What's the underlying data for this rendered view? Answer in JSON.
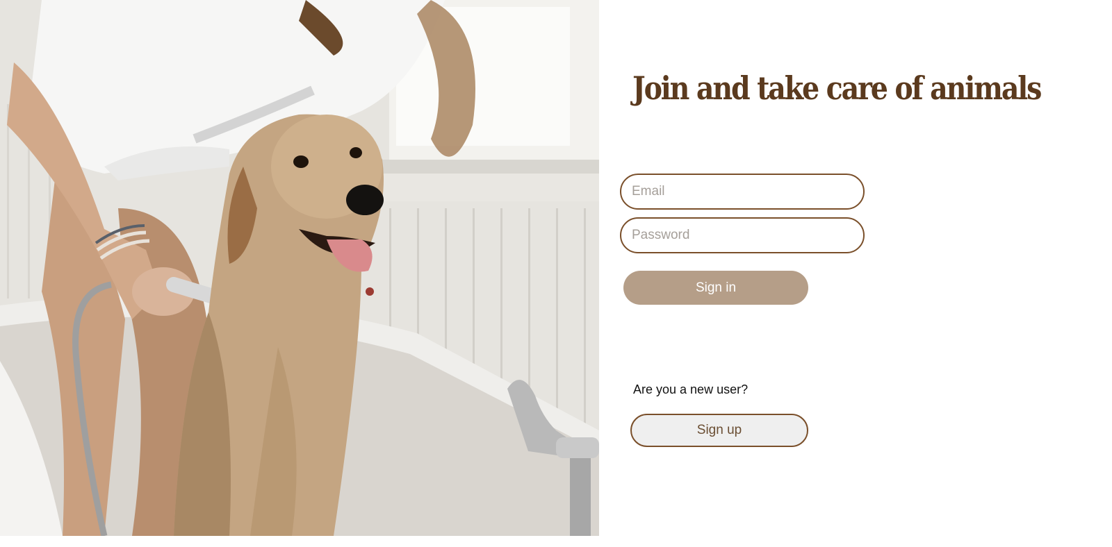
{
  "hero": {
    "image": "woman-bathing-golden-retriever-photo"
  },
  "headline": "Join and take care of animals",
  "login": {
    "email_placeholder": "Email",
    "password_placeholder": "Password",
    "signin_label": "Sign in"
  },
  "signup": {
    "prompt": "Are you a new user?",
    "signup_label": "Sign up"
  },
  "colors": {
    "brand_brown": "#5b3a1e",
    "field_border": "#7a4f2a",
    "signin_bg": "#b59e88",
    "signup_bg": "#efefef"
  }
}
